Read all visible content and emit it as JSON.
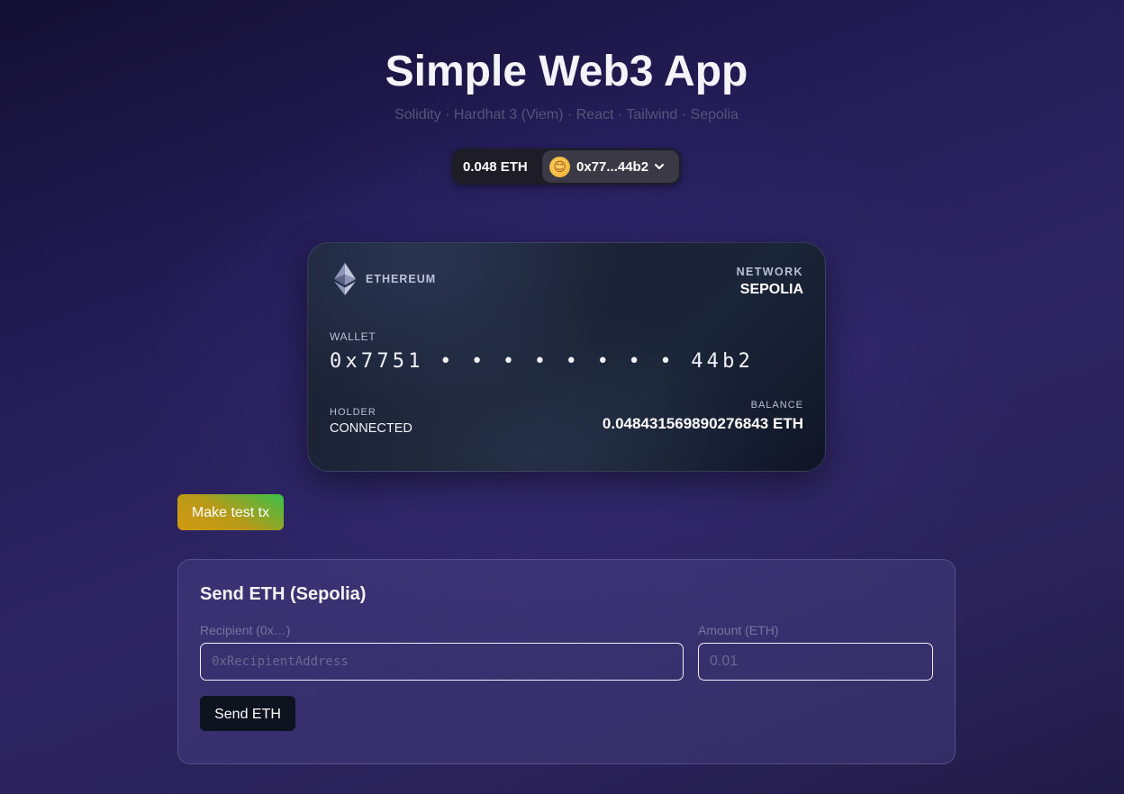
{
  "header": {
    "title": "Simple Web3 App",
    "subtitle": "Solidity · Hardhat 3 (Viem) · React · Tailwind · Sepolia"
  },
  "wallet_button": {
    "balance": "0.048 ETH",
    "address": "0x77...44b2",
    "avatar_emoji": "😊",
    "chevron_icon": "chevron-down-icon"
  },
  "card": {
    "brand_icon": "ethereum-icon",
    "brand_label": "ETHEREUM",
    "network_label": "NETWORK",
    "network_value": "SEPOLIA",
    "wallet_label": "WALLET",
    "wallet_number": "0x7751 • • • • • • • • 44b2",
    "holder_label": "HOLDER",
    "holder_value": "CONNECTED",
    "balance_label": "BALANCE",
    "balance_value": "0.04843156989027684​3 ETH"
  },
  "actions": {
    "test_tx_label": "Make test tx"
  },
  "send_form": {
    "title": "Send ETH (Sepolia)",
    "recipient_label": "Recipient (0x…)",
    "recipient_placeholder": "0xRecipientAddress",
    "recipient_value": "",
    "amount_label": "Amount (ETH)",
    "amount_placeholder": "0.01",
    "amount_value": "",
    "submit_label": "Send ETH"
  },
  "colors": {
    "background": "#231c55",
    "card": "#1a2234",
    "test_button_gradient": [
      "#d29a10",
      "#39c149"
    ],
    "send_button": "#0e1320"
  }
}
